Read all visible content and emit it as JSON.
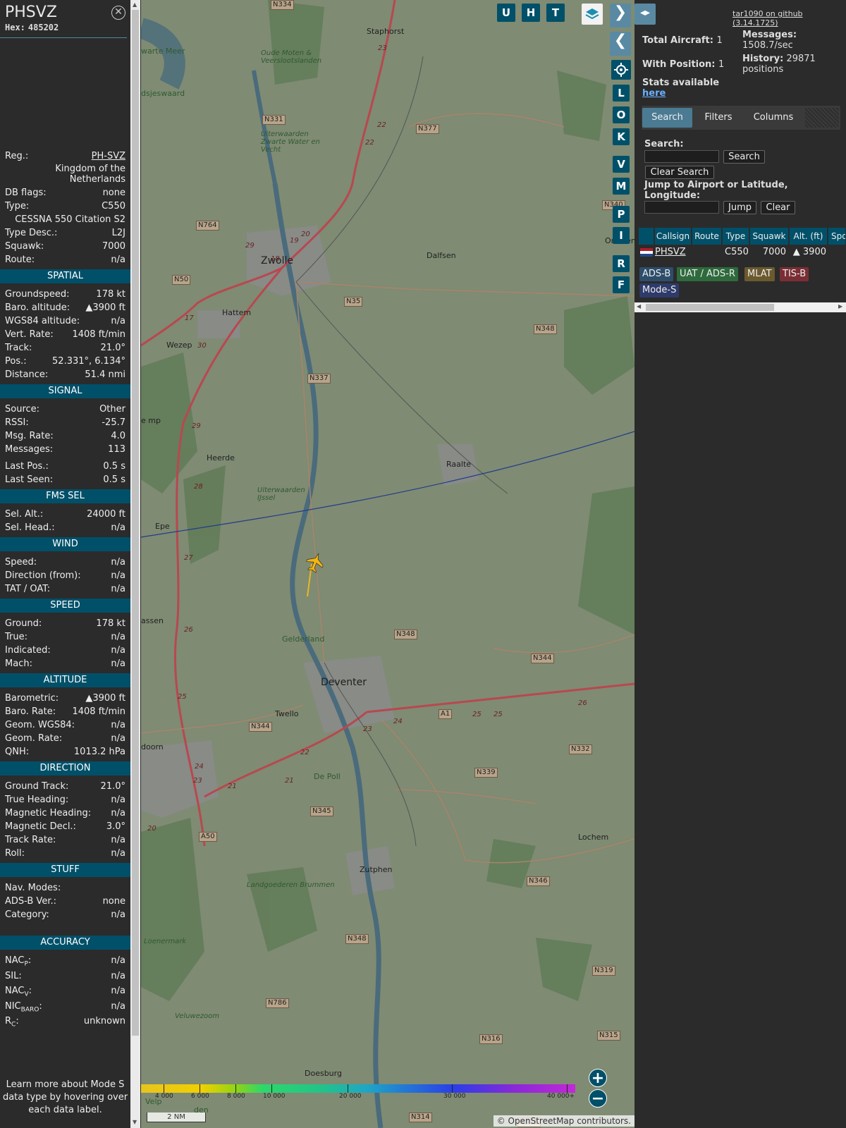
{
  "info": {
    "callsign": "PHSVZ",
    "hex_label": "Hex:",
    "hex": "485202",
    "rows_top": [
      {
        "label": "Reg.:",
        "value": "PH-SVZ",
        "link": true
      },
      {
        "label": "",
        "value": "Kingdom of the Netherlands"
      },
      {
        "label": "DB flags:",
        "value": "none"
      },
      {
        "label": "Type:",
        "value": "C550"
      },
      {
        "label": "",
        "value": "CESSNA 550 Citation S2"
      },
      {
        "label": "Type Desc.:",
        "value": "L2J"
      },
      {
        "label": "Squawk:",
        "value": "7000"
      },
      {
        "label": "Route:",
        "value": "n/a"
      }
    ],
    "sections": [
      {
        "title": "SPATIAL",
        "rows": [
          {
            "label": "Groundspeed:",
            "value": "178 kt"
          },
          {
            "label": "Baro. altitude:",
            "value": "▲3900 ft"
          },
          {
            "label": "WGS84 altitude:",
            "value": "n/a"
          },
          {
            "label": "Vert. Rate:",
            "value": "1408 ft/min"
          },
          {
            "label": "Track:",
            "value": "21.0°"
          },
          {
            "label": "Pos.:",
            "value": "52.331°, 6.134°"
          },
          {
            "label": "Distance:",
            "value": "51.4 nmi"
          }
        ]
      },
      {
        "title": "SIGNAL",
        "rows": [
          {
            "label": "Source:",
            "value": "Other"
          },
          {
            "label": "RSSI:",
            "value": "-25.7"
          },
          {
            "label": "Msg. Rate:",
            "value": "4.0"
          },
          {
            "label": "Messages:",
            "value": "113"
          },
          {
            "label": "Last Pos.:",
            "value": "0.5 s"
          },
          {
            "label": "Last Seen:",
            "value": "0.5 s"
          }
        ]
      },
      {
        "title": "FMS SEL",
        "rows": [
          {
            "label": "Sel. Alt.:",
            "value": "24000 ft"
          },
          {
            "label": "Sel. Head.:",
            "value": "n/a"
          }
        ]
      },
      {
        "title": "WIND",
        "rows": [
          {
            "label": "Speed:",
            "value": "n/a"
          },
          {
            "label": "Direction (from):",
            "value": "n/a"
          },
          {
            "label": "TAT / OAT:",
            "value": "n/a"
          }
        ]
      },
      {
        "title": "SPEED",
        "rows": [
          {
            "label": "Ground:",
            "value": "178 kt"
          },
          {
            "label": "True:",
            "value": "n/a"
          },
          {
            "label": "Indicated:",
            "value": "n/a"
          },
          {
            "label": "Mach:",
            "value": "n/a"
          }
        ]
      },
      {
        "title": "ALTITUDE",
        "rows": [
          {
            "label": "Barometric:",
            "value": "▲3900 ft"
          },
          {
            "label": "Baro. Rate:",
            "value": "1408 ft/min"
          },
          {
            "label": "Geom. WGS84:",
            "value": "n/a"
          },
          {
            "label": "Geom. Rate:",
            "value": "n/a"
          },
          {
            "label": "QNH:",
            "value": "1013.2 hPa"
          }
        ]
      },
      {
        "title": "DIRECTION",
        "rows": [
          {
            "label": "Ground Track:",
            "value": "21.0°"
          },
          {
            "label": "True Heading:",
            "value": "n/a"
          },
          {
            "label": "Magnetic Heading:",
            "value": "n/a"
          },
          {
            "label": "Magnetic Decl.:",
            "value": "3.0°"
          },
          {
            "label": "Track Rate:",
            "value": "n/a"
          },
          {
            "label": "Roll:",
            "value": "n/a"
          }
        ]
      },
      {
        "title": "STUFF",
        "rows": [
          {
            "label": "Nav. Modes:",
            "value": ""
          },
          {
            "label": "ADS-B Ver.:",
            "value": "none"
          },
          {
            "label": "Category:",
            "value": "n/a"
          }
        ]
      },
      {
        "title": "ACCURACY",
        "rows": [
          {
            "label": "NAC",
            "sub": "P",
            "suffix": ":",
            "value": "n/a"
          },
          {
            "label": "SIL:",
            "value": "n/a"
          },
          {
            "label": "NAC",
            "sub": "V",
            "suffix": ":",
            "value": "n/a"
          },
          {
            "label": "NIC",
            "sub": "BARO",
            "suffix": ":",
            "value": "n/a"
          },
          {
            "label": "R",
            "sub": "C",
            "suffix": ":",
            "value": "unknown"
          }
        ]
      }
    ],
    "footnote": "Learn more about Mode S data type by hovering over each data label."
  },
  "map": {
    "top_buttons": [
      "U",
      "H",
      "T"
    ],
    "side_buttons": [
      "L",
      "O",
      "K",
      "V",
      "M",
      "P",
      "I",
      "R",
      "F"
    ],
    "places": [
      {
        "name": "Staphorst"
      },
      {
        "name": "Zwolle"
      },
      {
        "name": "Dalfsen"
      },
      {
        "name": "Hattem"
      },
      {
        "name": "Wezep"
      },
      {
        "name": "Heerde"
      },
      {
        "name": "Raalte"
      },
      {
        "name": "Epe"
      },
      {
        "name": "Deventer"
      },
      {
        "name": "Twello"
      },
      {
        "name": "Zutphen"
      },
      {
        "name": "Lochem"
      },
      {
        "name": "Doesburg"
      },
      {
        "name": "Ommen"
      },
      {
        "name": "assen"
      },
      {
        "name": "doorn"
      },
      {
        "name": "Oude Moten & Veerslootslanden"
      },
      {
        "name": "Uiterwaarden Zwarte Water en Vecht"
      },
      {
        "name": "Uiterwaarden IJssel"
      },
      {
        "name": "Gelderland"
      },
      {
        "name": "De Poll"
      },
      {
        "name": "Landgoederen Brummen"
      },
      {
        "name": "Veluwezoom"
      },
      {
        "name": "Loenermark"
      },
      {
        "name": "Velp"
      },
      {
        "name": "den"
      },
      {
        "name": "dsjeswaard"
      },
      {
        "name": "warte Meer"
      },
      {
        "name": "e mp"
      }
    ],
    "roads": [
      "N334",
      "N331",
      "N377",
      "N764",
      "N50",
      "N35",
      "N348",
      "N337",
      "N340",
      "N344",
      "N344",
      "A1",
      "N332",
      "N339",
      "N345",
      "A50",
      "N346",
      "N348",
      "N319",
      "N786",
      "N316",
      "N315",
      "N315",
      "N314",
      "N348"
    ],
    "road_numbers": [
      "23",
      "22",
      "22",
      "20",
      "19",
      "18",
      "29",
      "17",
      "30",
      "29",
      "28",
      "27",
      "26",
      "25",
      "24",
      "23",
      "22",
      "21",
      "21",
      "20",
      "24",
      "23",
      "25",
      "25",
      "26"
    ],
    "legend_ticks": [
      "4 000",
      "6 000",
      "8 000",
      "10 000",
      "20 000",
      "30 000",
      "40 000+"
    ],
    "scale": "2 NM",
    "attribution": "© OpenStreetMap contributors.",
    "zoom_in": "+",
    "zoom_out": "−"
  },
  "right": {
    "github_link": "tar1090 on github (3.14.1725)",
    "total_aircraft_label": "Total Aircraft:",
    "total_aircraft": "1",
    "with_position_label": "With Position:",
    "with_position": "1",
    "messages_label": "Messages:",
    "messages_value": "1508.7/sec",
    "history_label": "History:",
    "history_value": "29871 positions",
    "stats_label": "Stats available",
    "stats_link": "here",
    "tabs": [
      "Search",
      "Filters",
      "Columns"
    ],
    "search_label": "Search:",
    "search_button": "Search",
    "clear_search_button": "Clear Search",
    "jump_label": "Jump to Airport or Latitude, Longitude:",
    "jump_button": "Jump",
    "clear_button": "Clear",
    "table_headers": [
      "",
      "Callsign",
      "Route",
      "Type",
      "Squawk",
      "Alt. (ft)",
      "Spd"
    ],
    "table_row": {
      "callsign": "PHSVZ",
      "route": "",
      "type": "C550",
      "squawk": "7000",
      "altitude": "▲ 3900"
    },
    "badges": [
      "ADS-B",
      "UAT / ADS-R",
      "MLAT",
      "TIS-B",
      "Mode-S"
    ],
    "colors": {
      "adsb": "#2e4d6a",
      "uat": "#2e6a3c",
      "mlat": "#6a5a2e",
      "tisb": "#7a2e34",
      "modes": "#2e3a6a"
    }
  }
}
